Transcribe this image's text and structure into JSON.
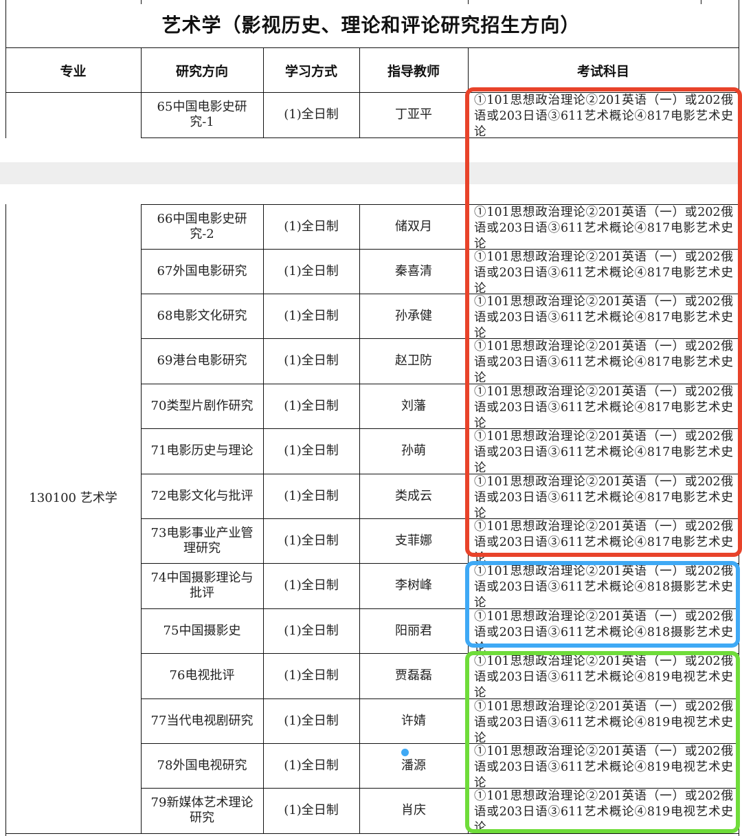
{
  "title": "艺术学（影视历史、理论和评论研究招生方向）",
  "headers": {
    "major": "专业",
    "direction": "研究方向",
    "mode": "学习方式",
    "advisor": "指导教师",
    "exam": "考试科目"
  },
  "major_cell": "130100 艺术学",
  "rows": [
    {
      "direction": "65中国电影史研究-1",
      "mode": "(1)全日制",
      "advisor": "丁亚平",
      "exam": "①101思想政治理论②201英语（一）或202俄语或203日语③611艺术概论④817电影艺术史论"
    },
    {
      "direction": "66中国电影史研究-2",
      "mode": "(1)全日制",
      "advisor": "储双月",
      "exam": "①101思想政治理论②201英语（一）或202俄语或203日语③611艺术概论④817电影艺术史论"
    },
    {
      "direction": "67外国电影研究",
      "mode": "(1)全日制",
      "advisor": "秦喜清",
      "exam": "①101思想政治理论②201英语（一）或202俄语或203日语③611艺术概论④817电影艺术史论"
    },
    {
      "direction": "68电影文化研究",
      "mode": "(1)全日制",
      "advisor": "孙承健",
      "exam": "①101思想政治理论②201英语（一）或202俄语或203日语③611艺术概论④817电影艺术史论"
    },
    {
      "direction": "69港台电影研究",
      "mode": "(1)全日制",
      "advisor": "赵卫防",
      "exam": "①101思想政治理论②201英语（一）或202俄语或203日语③611艺术概论④817电影艺术史论"
    },
    {
      "direction": "70类型片剧作研究",
      "mode": "(1)全日制",
      "advisor": "刘藩",
      "exam": "①101思想政治理论②201英语（一）或202俄语或203日语③611艺术概论④817电影艺术史论"
    },
    {
      "direction": "71电影历史与理论",
      "mode": "(1)全日制",
      "advisor": "孙萌",
      "exam": "①101思想政治理论②201英语（一）或202俄语或203日语③611艺术概论④817电影艺术史论"
    },
    {
      "direction": "72电影文化与批评",
      "mode": "(1)全日制",
      "advisor": "类成云",
      "exam": "①101思想政治理论②201英语（一）或202俄语或203日语③611艺术概论④817电影艺术史论"
    },
    {
      "direction": "73电影事业产业管理研究",
      "mode": "(1)全日制",
      "advisor": "支菲娜",
      "exam": "①101思想政治理论②201英语（一）或202俄语或203日语③611艺术概论④817电影艺术史论"
    },
    {
      "direction": "74中国摄影理论与批评",
      "mode": "(1)全日制",
      "advisor": "李树峰",
      "exam": "①101思想政治理论②201英语（一）或202俄语或203日语③611艺术概论④818摄影艺术史论"
    },
    {
      "direction": "75中国摄影史",
      "mode": "(1)全日制",
      "advisor": "阳丽君",
      "exam": "①101思想政治理论②201英语（一）或202俄语或203日语③611艺术概论④818摄影艺术史论"
    },
    {
      "direction": "76电视批评",
      "mode": "(1)全日制",
      "advisor": "贾磊磊",
      "exam": "①101思想政治理论②201英语（一）或202俄语或203日语③611艺术概论④819电视艺术史论"
    },
    {
      "direction": "77当代电视剧研究",
      "mode": "(1)全日制",
      "advisor": "许婧",
      "exam": "①101思想政治理论②201英语（一）或202俄语或203日语③611艺术概论④819电视艺术史论"
    },
    {
      "direction": "78外国电视研究",
      "mode": "(1)全日制",
      "advisor": "潘源",
      "exam": "①101思想政治理论②201英语（一）或202俄语或203日语③611艺术概论④819电视艺术史论"
    },
    {
      "direction": "79新媒体艺术理论研究",
      "mode": "(1)全日制",
      "advisor": "肖庆",
      "exam": "①101思想政治理论②201英语（一）或202俄语或203日语③611艺术概论④819电视艺术史论"
    }
  ],
  "highlights": [
    {
      "name": "film-history-exam-highlight",
      "color": "#e8432a",
      "rows": [
        0,
        8
      ]
    },
    {
      "name": "photography-exam-highlight",
      "color": "#3fa9f5",
      "rows": [
        9,
        10
      ]
    },
    {
      "name": "television-exam-highlight",
      "color": "#6fdc3a",
      "rows": [
        11,
        14
      ]
    }
  ],
  "marker_color": "#3fa9f5"
}
